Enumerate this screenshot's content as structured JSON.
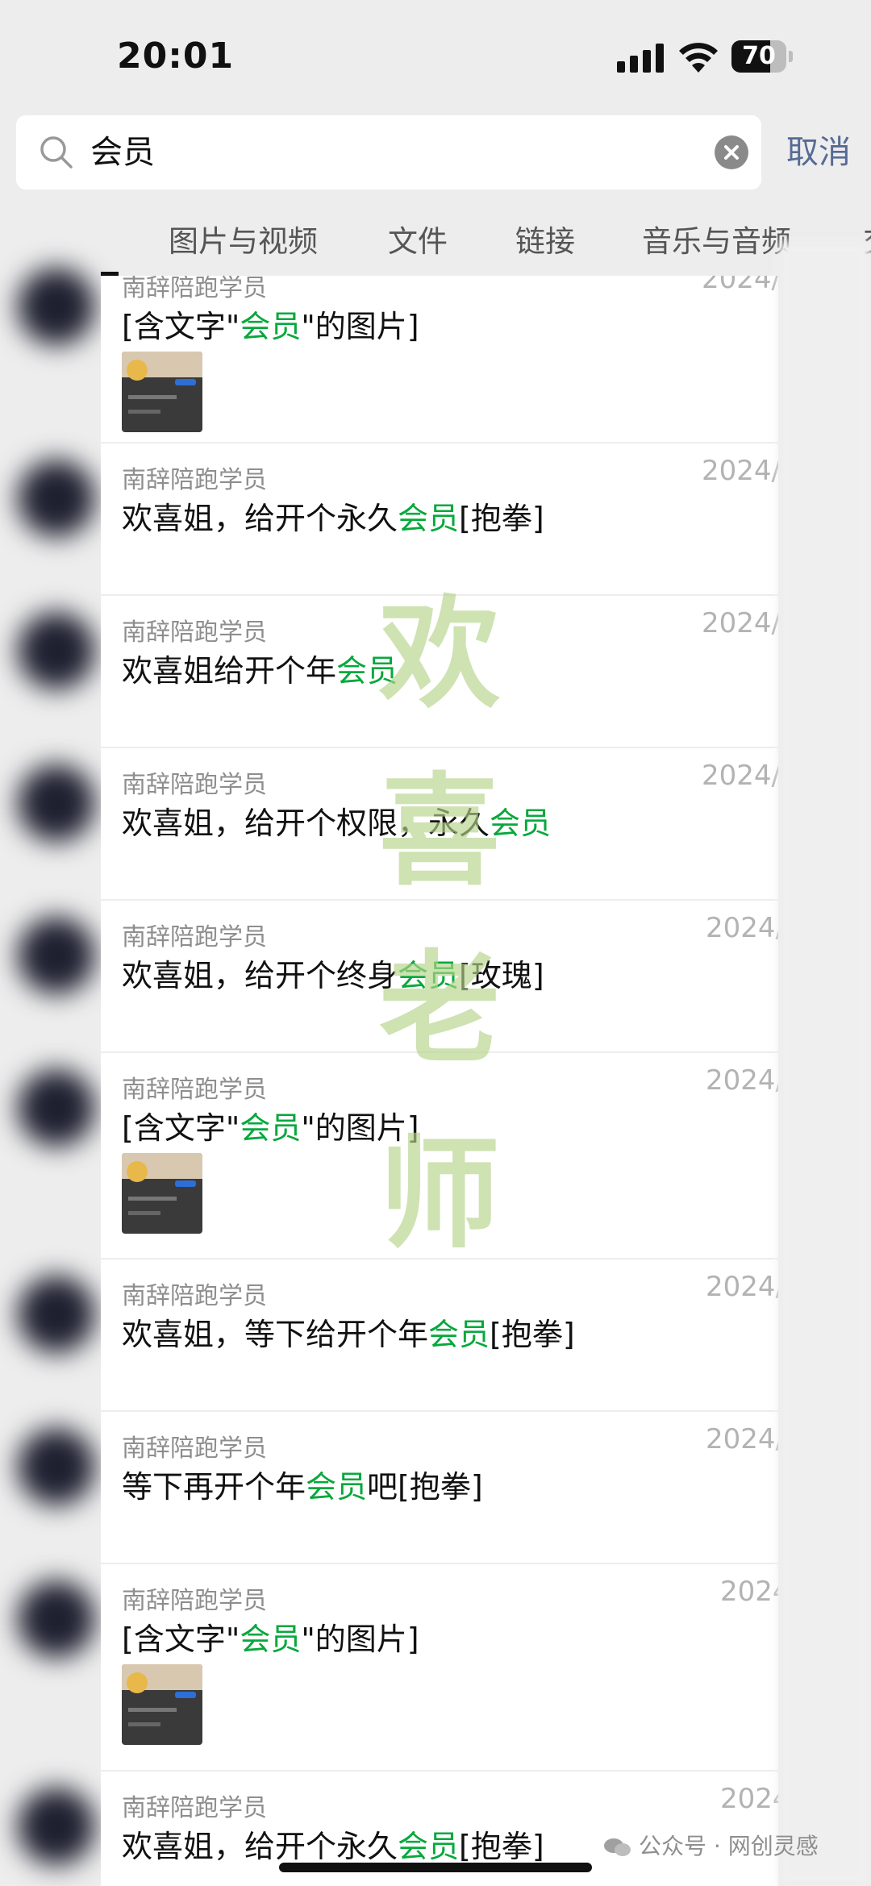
{
  "status_bar": {
    "time": "20:01",
    "battery": "70",
    "battery_level": 0.7
  },
  "search": {
    "query": "会员",
    "cancel_label": "取消"
  },
  "tabs": [
    "图片与视频",
    "文件",
    "链接",
    "音乐与音频",
    "交"
  ],
  "results": [
    {
      "sender": "南辞陪跑学员",
      "date": "2024/",
      "parts": [
        [
          "[含文字\"",
          false
        ],
        [
          "会员",
          true
        ],
        [
          "\"的图片]",
          false
        ]
      ],
      "image": true
    },
    {
      "sender": "南辞陪跑学员",
      "date": "2024/",
      "parts": [
        [
          "欢喜姐，给开个永久",
          false
        ],
        [
          "会员",
          true
        ],
        [
          "[抱拳]",
          false
        ]
      ],
      "image": false
    },
    {
      "sender": "南辞陪跑学员",
      "date": "2024/",
      "parts": [
        [
          "欢喜姐给开个年",
          false
        ],
        [
          "会员",
          true
        ]
      ],
      "image": false
    },
    {
      "sender": "南辞陪跑学员",
      "date": "2024/",
      "parts": [
        [
          "欢喜姐，给开个权限，永久",
          false
        ],
        [
          "会员",
          true
        ]
      ],
      "image": false
    },
    {
      "sender": "南辞陪跑学员",
      "date": "2024/",
      "parts": [
        [
          "欢喜姐，给开个终身",
          false
        ],
        [
          "会员",
          true
        ],
        [
          "[玫瑰]",
          false
        ]
      ],
      "image": false
    },
    {
      "sender": "南辞陪跑学员",
      "date": "2024/",
      "parts": [
        [
          "[含文字\"",
          false
        ],
        [
          "会员",
          true
        ],
        [
          "\"的图片]",
          false
        ]
      ],
      "image": true
    },
    {
      "sender": "南辞陪跑学员",
      "date": "2024/",
      "parts": [
        [
          "欢喜姐，等下给开个年",
          false
        ],
        [
          "会员",
          true
        ],
        [
          "[抱拳]",
          false
        ]
      ],
      "image": false
    },
    {
      "sender": "南辞陪跑学员",
      "date": "2024/",
      "parts": [
        [
          "等下再开个年",
          false
        ],
        [
          "会员",
          true
        ],
        [
          "吧[抱拳]",
          false
        ]
      ],
      "image": false
    },
    {
      "sender": "南辞陪跑学员",
      "date": "2024",
      "parts": [
        [
          "[含文字\"",
          false
        ],
        [
          "会员",
          true
        ],
        [
          "\"的图片]",
          false
        ]
      ],
      "image": true
    },
    {
      "sender": "南辞陪跑学员",
      "date": "2024",
      "parts": [
        [
          "欢喜姐，给开个永久",
          false
        ],
        [
          "会员",
          true
        ],
        [
          "[抱拳]",
          false
        ]
      ],
      "image": false
    }
  ],
  "watermark": [
    "欢",
    "喜",
    "老",
    "师"
  ],
  "footer": "公众号 · 网创灵感",
  "colors": {
    "highlight": "#07a83c",
    "cancel": "#576b95",
    "watermark": "#b4d38a"
  },
  "icons": [
    "search-icon",
    "clear-icon",
    "signal-icon",
    "wifi-icon",
    "battery-icon",
    "wechat-icon"
  ]
}
